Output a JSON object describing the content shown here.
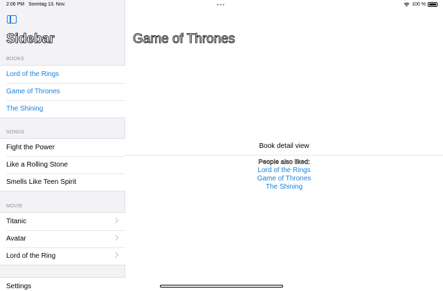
{
  "status_bar": {
    "time": "2:06 PM",
    "date": "Sonntag 13. Nov.",
    "multitask_dots": "•••",
    "battery_percent": "100 %"
  },
  "sidebar": {
    "title": "Sidebar",
    "sections": {
      "books": {
        "header": "BOOKS",
        "items": [
          "Lord of the Rings",
          "Game of Thrones",
          "The Shining"
        ]
      },
      "songs": {
        "header": "SONGS",
        "items": [
          "Fight the Power",
          "Like a Rolling Stone",
          "Smells Like Teen Spirit"
        ]
      },
      "movie": {
        "header": "MOVIE",
        "items": [
          "Titanic",
          "Avatar",
          "Lord of the Ring"
        ]
      },
      "settings": {
        "items": [
          "Settings"
        ]
      }
    }
  },
  "detail": {
    "title": "Game of Thrones",
    "label": "Book detail view",
    "also_liked_header": "People also liked:",
    "also_liked": [
      "Lord of the Rings",
      "Game of Thrones",
      "The Shining"
    ]
  },
  "colors": {
    "accent": "#1a7fe0",
    "sidebar_bg": "#f2f2f7",
    "secondary_text": "#8e8e93"
  },
  "icons": {
    "sidebar_toggle": "sidebar-toggle-icon",
    "chevron": "chevron-right-icon",
    "wifi": "wifi-icon",
    "battery": "battery-icon"
  }
}
